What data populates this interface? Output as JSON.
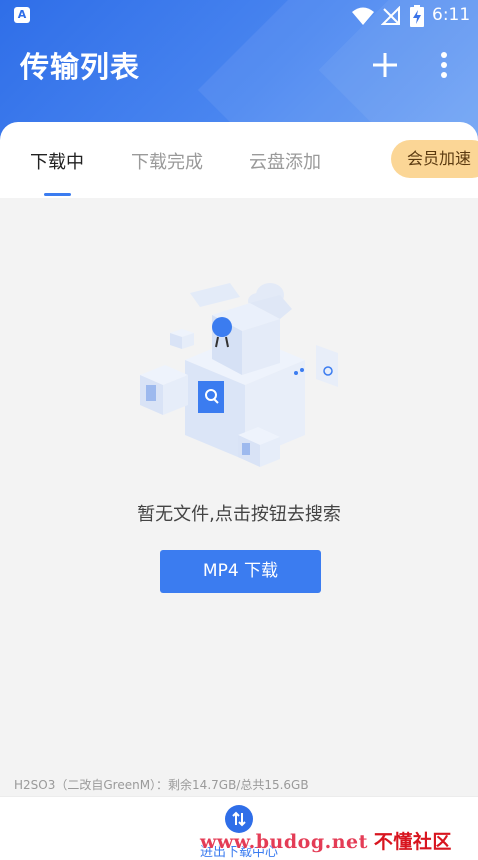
{
  "status_bar": {
    "app_icon_letter": "A",
    "time": "6:11",
    "icons": [
      "wifi-icon",
      "no-signal-icon",
      "battery-charging-icon"
    ]
  },
  "header": {
    "title": "传输列表",
    "add_icon": "plus-icon",
    "more_icon": "more-vertical-icon"
  },
  "tabs": [
    {
      "label": "下载中",
      "active": true
    },
    {
      "label": "下载完成",
      "active": false
    },
    {
      "label": "云盘添加",
      "active": false
    }
  ],
  "vip_button": {
    "label": "会员加速"
  },
  "empty_state": {
    "message": "暂无文件,点击按钮去搜索",
    "button_label": "MP4 下载"
  },
  "storage_info": "H2SO3（二改自GreenM）：剩余14.7GB/总共15.6GB",
  "bottom_bar": {
    "icon": "download-center-icon",
    "label": "进出下载中心"
  },
  "watermark": {
    "text": "www.budog.net",
    "cn_text": "不懂社区"
  },
  "colors": {
    "primary": "#3b7cf0",
    "header_gradient_start": "#2f6ee8",
    "vip_bg": "#fbd696",
    "background": "#f3f3f3"
  }
}
